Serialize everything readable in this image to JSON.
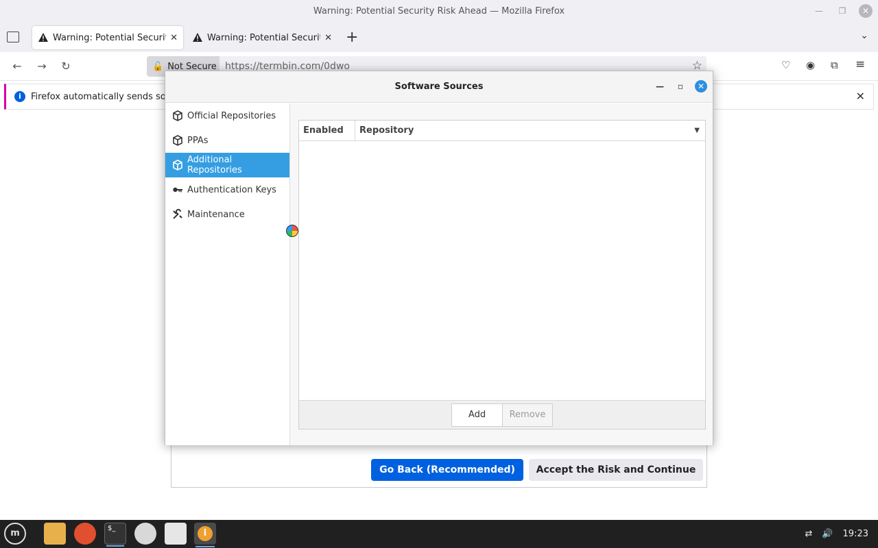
{
  "window": {
    "title": "Warning: Potential Security Risk Ahead — Mozilla Firefox"
  },
  "tabs": [
    {
      "label": "Warning: Potential Security R",
      "active": true
    },
    {
      "label": "Warning: Potential Security R",
      "active": false
    }
  ],
  "nav": {
    "not_secure": "Not Secure",
    "url": "https://termbin.com/0dwo"
  },
  "notification": {
    "text": "Firefox automatically sends some"
  },
  "page": {
    "go_back": "Go Back (Recommended)",
    "accept": "Accept the Risk and Continue"
  },
  "dialog": {
    "title": "Software Sources",
    "sidebar": [
      {
        "label": "Official Repositories",
        "icon": "package-icon"
      },
      {
        "label": "PPAs",
        "icon": "package-icon"
      },
      {
        "label": "Additional Repositories",
        "icon": "package-icon",
        "selected": true
      },
      {
        "label": "Authentication Keys",
        "icon": "key-icon"
      },
      {
        "label": "Maintenance",
        "icon": "tools-icon"
      }
    ],
    "table": {
      "col_enabled": "Enabled",
      "col_repository": "Repository"
    },
    "buttons": {
      "add": "Add",
      "remove": "Remove"
    }
  },
  "taskbar": {
    "clock": "19:23"
  },
  "colors": {
    "accent_blue": "#359ee2",
    "firefox_blue": "#0061e0",
    "taskbar": "#202020"
  }
}
